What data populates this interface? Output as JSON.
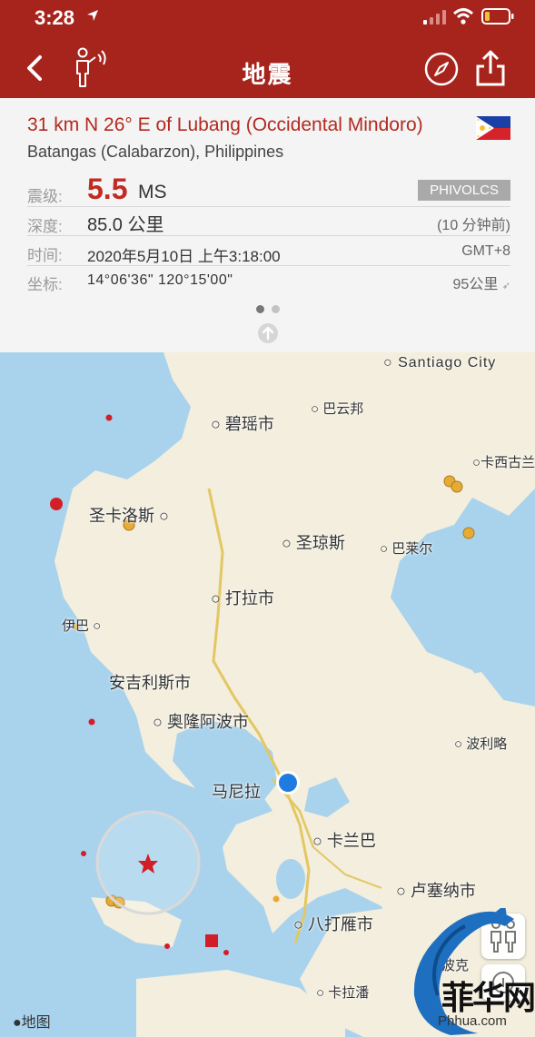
{
  "status_bar": {
    "time": "3:28"
  },
  "nav": {
    "title": "地震"
  },
  "quake": {
    "headline": "31 km N 26° E of Lubang (Occidental Mindoro)",
    "region": "Batangas (Calabarzon), Philippines",
    "magnitude_label": "震级:",
    "magnitude_value": "5.5",
    "magnitude_unit": "MS",
    "agency": "PHIVOLCS",
    "depth_label": "深度:",
    "depth_value": "85.0 公里",
    "depth_ago": "(10 分钟前)",
    "time_label": "时间:",
    "time_value": "2020年5月10日 上午3:18:00",
    "timezone": "GMT+8",
    "coord_label": "坐标:",
    "coord_value": "14°06'36\"   120°15'00\"",
    "distance": "95公里"
  },
  "pager": {
    "pages": 2,
    "active": 0
  },
  "map": {
    "places": {
      "santiago": "Santiago City",
      "baguio": "碧瑶市",
      "bayombong": "巴云邦",
      "casiguran": "卡西古兰",
      "sancarlos": "圣卡洛斯",
      "sanjose": "圣琼斯",
      "baler": "巴莱尔",
      "tarlac": "打拉市",
      "iba": "伊巴",
      "angeles": "安吉利斯市",
      "olongapo": "奥隆阿波市",
      "polillo": "波利略",
      "manila": "马尼拉",
      "calamba": "卡兰巴",
      "lucena": "卢塞纳市",
      "batangas": "八打雁市",
      "calapan": "卡拉潘",
      "boac": "波克"
    },
    "maps_label": "地图"
  },
  "watermark": {
    "text": "菲华网",
    "url": "Phhua.com"
  },
  "colors": {
    "header": "#a7241d",
    "headline": "#b22a20",
    "magnitude": "#c22b22",
    "sea": "#a9d3ec",
    "land": "#f3eedd",
    "road": "#e3c763",
    "quake_small": "#e6ab34",
    "quake_recent": "#d21f27",
    "user_location": "#1e7be0"
  }
}
